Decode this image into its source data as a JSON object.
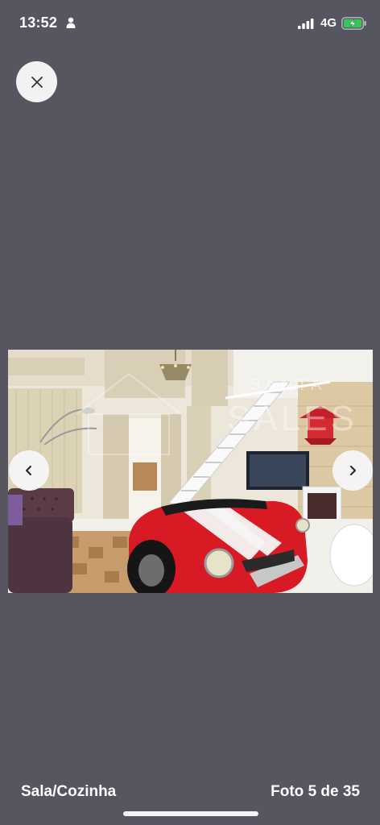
{
  "status_bar": {
    "time": "13:52",
    "network": "4G",
    "icons": [
      "person-icon",
      "signal-icon",
      "battery-charging-icon"
    ],
    "battery_color": "#35c759"
  },
  "viewer": {
    "close_icon": "close-icon",
    "prev_icon": "chevron-left-icon",
    "next_icon": "chevron-right-icon",
    "photo_subject": "Living room with red vintage car sofa, staircase and chandelier",
    "watermark": "SANTA SALES",
    "caption": "Sala/Cozinha",
    "counter": "Foto 5 de 35"
  },
  "colors": {
    "background": "#555660",
    "button_bg": "#f2f2f2",
    "car_red": "#d81a24"
  }
}
